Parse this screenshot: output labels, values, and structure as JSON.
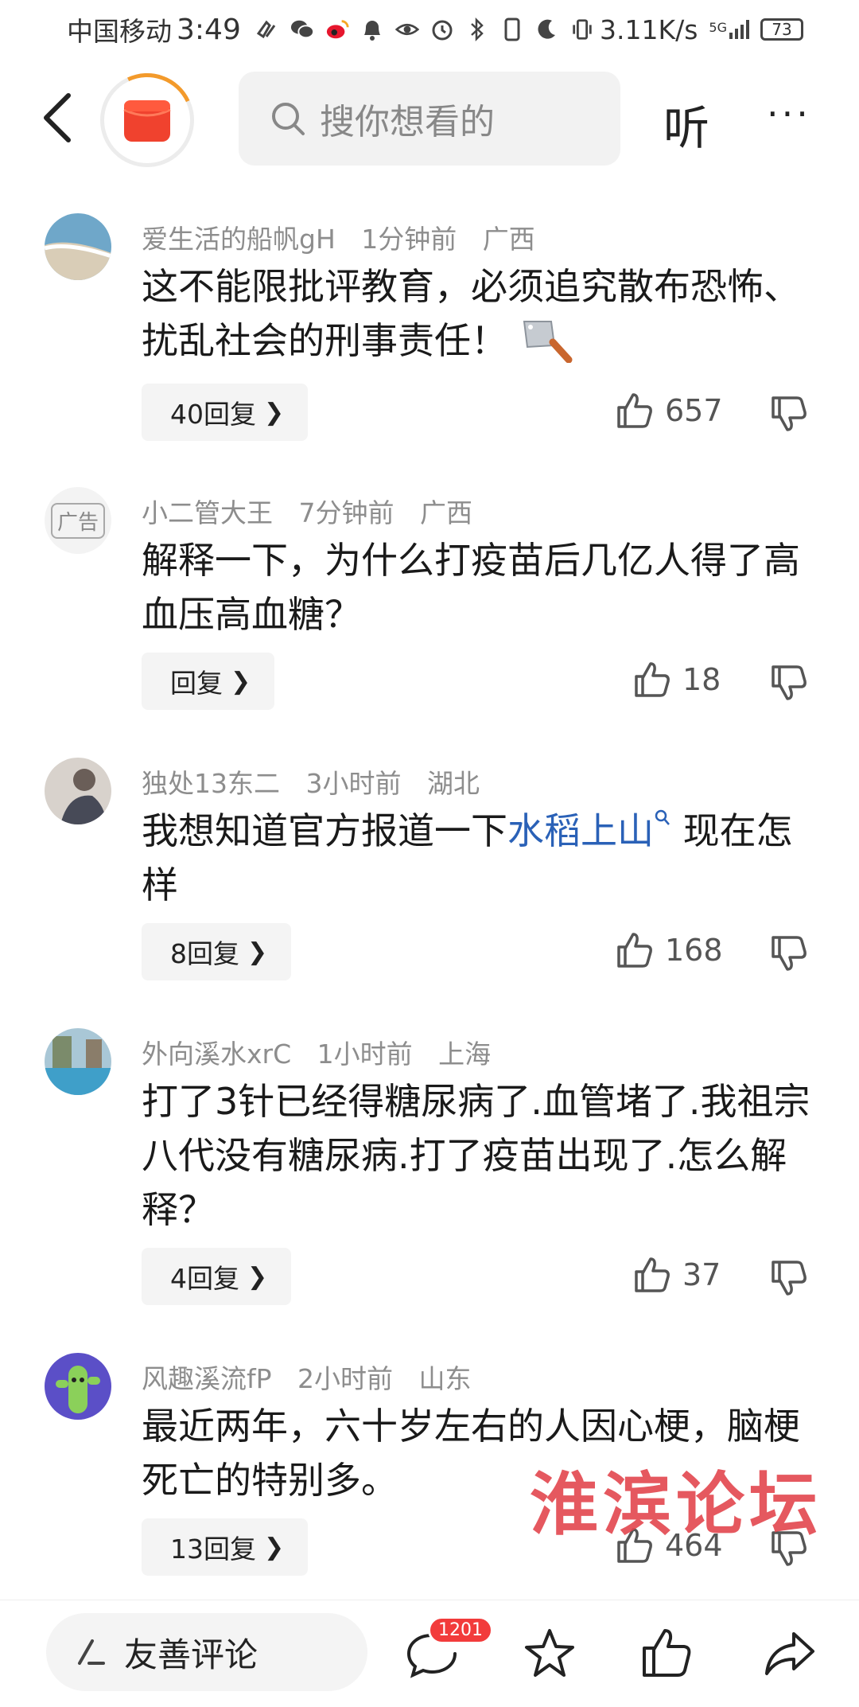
{
  "status_bar": {
    "carrier": "中国移动",
    "time": "3:49",
    "net_speed": "3.11K/s",
    "signal": "5G",
    "battery": "73"
  },
  "top_nav": {
    "search_placeholder": "搜你想看的",
    "listen_label": "听",
    "more_label": "···"
  },
  "comments": [
    {
      "user": "爱生活的船帆gH",
      "time": "1分钟前",
      "location": "广西",
      "text": "这不能限批评教育，必须追究散布恐怖、扰乱社会的刑事责任！",
      "reply_label": "40回复",
      "likes": "657"
    },
    {
      "user": "小二管大王",
      "time": "7分钟前",
      "location": "广西",
      "avatar_label": "广告",
      "text": "解释一下，为什么打疫苗后几亿人得了高血压高血糖？",
      "reply_label": "回复",
      "likes": "18"
    },
    {
      "user": "独处13东二",
      "time": "3小时前",
      "location": "湖北",
      "text_before": "我想知道官方报道一下",
      "topic": "水稻上山",
      "text_after": " 现在怎样",
      "reply_label": "8回复",
      "likes": "168"
    },
    {
      "user": "外向溪水xrC",
      "time": "1小时前",
      "location": "上海",
      "text": "打了3针已经得糖尿病了.血管堵了.我祖宗八代没有糖尿病.打了疫苗出现了.怎么解释？",
      "reply_label": "4回复",
      "likes": "37"
    },
    {
      "user": "风趣溪流fP",
      "time": "2小时前",
      "location": "山东",
      "text": "最近两年，六十岁左右的人因心梗，脑梗死亡的特别多。",
      "reply_label": "13回复",
      "likes": "464"
    }
  ],
  "watermark": "淮滨论坛",
  "bottom_bar": {
    "input_label": "友善评论",
    "comment_count": "1201"
  },
  "colors": {
    "accent_red": "#f23b3b",
    "topic_blue": "#2a61b7",
    "progress_orange": "#f39a2b"
  }
}
